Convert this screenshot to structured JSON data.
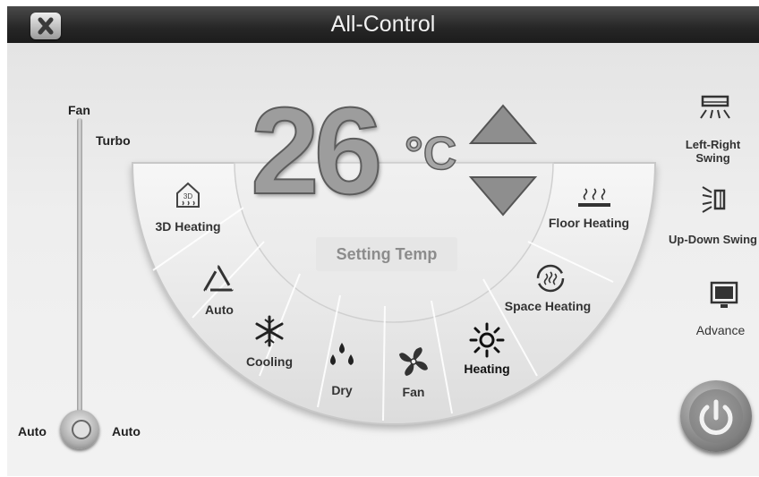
{
  "window": {
    "title": "All-Control"
  },
  "temperature": {
    "value": "26",
    "unit": "°C",
    "label": "Setting Temp"
  },
  "fan_slider": {
    "top_label": "Fan",
    "turbo_label": "Turbo",
    "left_label": "Auto",
    "right_label": "Auto"
  },
  "modes": {
    "heating_3d": "3D Heating",
    "auto": "Auto",
    "cooling": "Cooling",
    "dry": "Dry",
    "fan": "Fan",
    "heating": "Heating",
    "space_heating": "Space Heating",
    "floor_heating": "Floor Heating"
  },
  "right_panel": {
    "left_right_swing": "Left-Right Swing",
    "up_down_swing": "Up-Down Swing",
    "advance": "Advance"
  },
  "icons": [
    "close-icon",
    "temp-up-icon",
    "temp-down-icon",
    "3d-heating-icon",
    "auto-mode-icon",
    "snowflake-icon",
    "water-drops-icon",
    "fan-icon",
    "sun-icon",
    "space-heating-icon",
    "floor-heating-icon",
    "left-right-swing-icon",
    "up-down-swing-icon",
    "monitor-icon",
    "power-icon"
  ],
  "colors": {
    "titlebar": "#262626",
    "accent": "#5a5a5a",
    "power": "#8a8a8a"
  }
}
